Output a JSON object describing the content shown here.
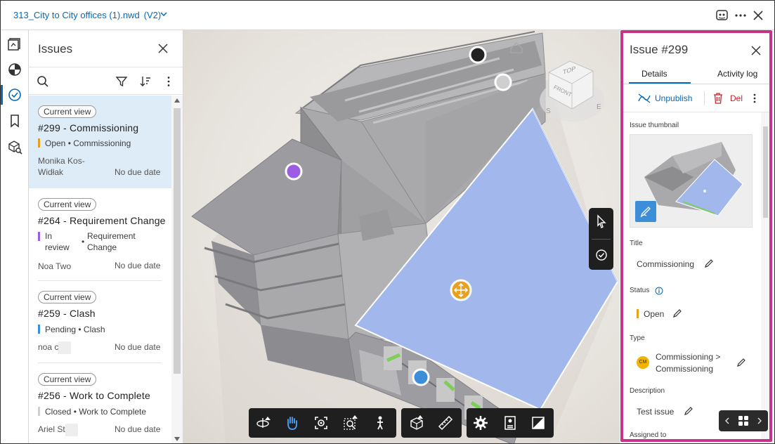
{
  "topbar": {
    "file_name": "313_City to City offices (1).nwd",
    "version": "(V2)",
    "icons": [
      "caret-down-icon",
      "chat-icon",
      "more-icon",
      "close-icon"
    ]
  },
  "rail": {
    "items": [
      "sheets-icon",
      "model-browser-icon",
      "issues-icon",
      "views-icon",
      "search-model-icon"
    ],
    "active": "issues-icon"
  },
  "issues_panel": {
    "title": "Issues",
    "tools": [
      "search-icon",
      "filter-icon",
      "sort-icon",
      "more-icon"
    ],
    "items": [
      {
        "tag": "Current view",
        "title": "#299 - Commissioning",
        "status": "Open",
        "type": "Commissioning",
        "status_color": "#e8a020",
        "assignee": "Monika Kos-Widłak",
        "due": "No due date",
        "selected": true
      },
      {
        "tag": "Current view",
        "title": "#264 - Requirement Change",
        "status": "In review",
        "type": "Requirement Change",
        "status_color": "#9b5de5",
        "assignee": "Noa Two",
        "due": "No due date",
        "selected": false
      },
      {
        "tag": "Current view",
        "title": "#259 - Clash",
        "status": "Pending",
        "type": "Clash",
        "status_color": "#3c8ed8",
        "assignee": "noa c",
        "due": "No due date",
        "selected": false
      },
      {
        "tag": "Current view",
        "title": "#256 - Work to Complete",
        "status": "Closed",
        "type": "Work to Complete",
        "status_color": "#cfcfcf",
        "assignee": "Ariel St",
        "due": "No due date",
        "selected": false
      }
    ]
  },
  "viewer": {
    "viewcube": {
      "top": "TOP",
      "front": "FRONT",
      "compass_s": "S",
      "compass_e": "E"
    },
    "pins": [
      {
        "kind": "dark",
        "color": "#222222"
      },
      {
        "kind": "gray",
        "color": "#cfcfcf"
      },
      {
        "kind": "purple",
        "color": "#9b5de5"
      },
      {
        "kind": "move",
        "color": "#e8a020"
      },
      {
        "kind": "blue",
        "color": "#3c8ed8"
      }
    ],
    "side_tools": [
      "select-pointer-icon",
      "issue-check-icon"
    ],
    "bottom_toolbar": [
      "orbit-icon",
      "pan-hand-icon",
      "fit-to-view-icon",
      "zoom-window-icon",
      "first-person-icon",
      "section-icon",
      "measure-icon",
      "settings-gear-icon",
      "properties-icon",
      "fullscreen-icon"
    ]
  },
  "details": {
    "title": "Issue #299",
    "tabs": [
      "Details",
      "Activity log"
    ],
    "active_tab": "Details",
    "unpublish_label": "Unpublish",
    "delete_label": "Del",
    "thumbnail_label": "Issue thumbnail",
    "title_label": "Title",
    "title_value": "Commissioning",
    "status_label": "Status",
    "status_value": "Open",
    "status_color": "#e8a020",
    "type_label": "Type",
    "type_badge": "CM",
    "type_badge_color": "#f0b400",
    "type_value_line1": "Commissioning >",
    "type_value_line2": "Commissioning",
    "description_label": "Description",
    "description_value": "Test issue",
    "assigned_label": "Assigned to",
    "highlight_color": "#c8338a"
  }
}
